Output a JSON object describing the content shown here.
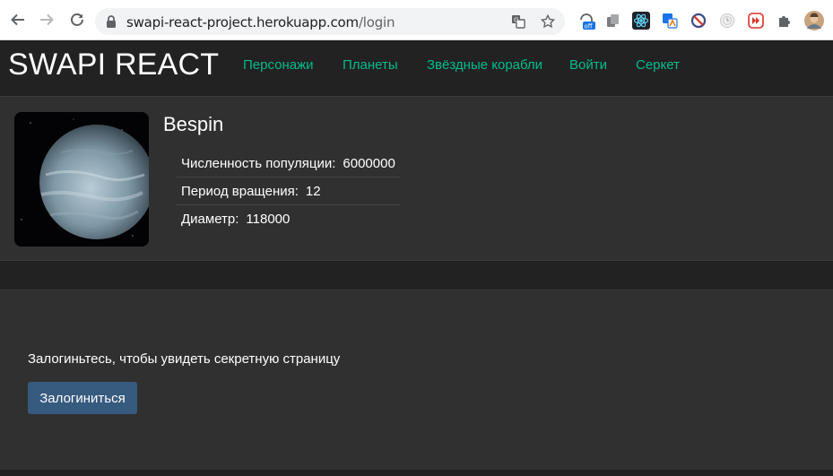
{
  "browser": {
    "url_host": "swapi-react-project.herokuapp.com",
    "url_path": "/login"
  },
  "navbar": {
    "brand": "SWAPI REACT",
    "links": [
      {
        "label": "Персонажи"
      },
      {
        "label": "Планеты"
      },
      {
        "label": "Звёздные корабли"
      },
      {
        "label": "Войти"
      },
      {
        "label": "Серкет"
      }
    ]
  },
  "planet": {
    "name": "Bespin",
    "properties": [
      {
        "term": "Численность популяции:",
        "value": "6000000"
      },
      {
        "term": "Период вращения:",
        "value": "12"
      },
      {
        "term": "Диаметр:",
        "value": "118000"
      }
    ]
  },
  "login": {
    "message": "Залогиньтесь, чтобы увидеть секретную страницу",
    "button_label": "Залогиниться"
  },
  "colors": {
    "accent": "#00bc8c",
    "primary_button": "#375a7f",
    "background": "#222222",
    "card": "#303030"
  }
}
